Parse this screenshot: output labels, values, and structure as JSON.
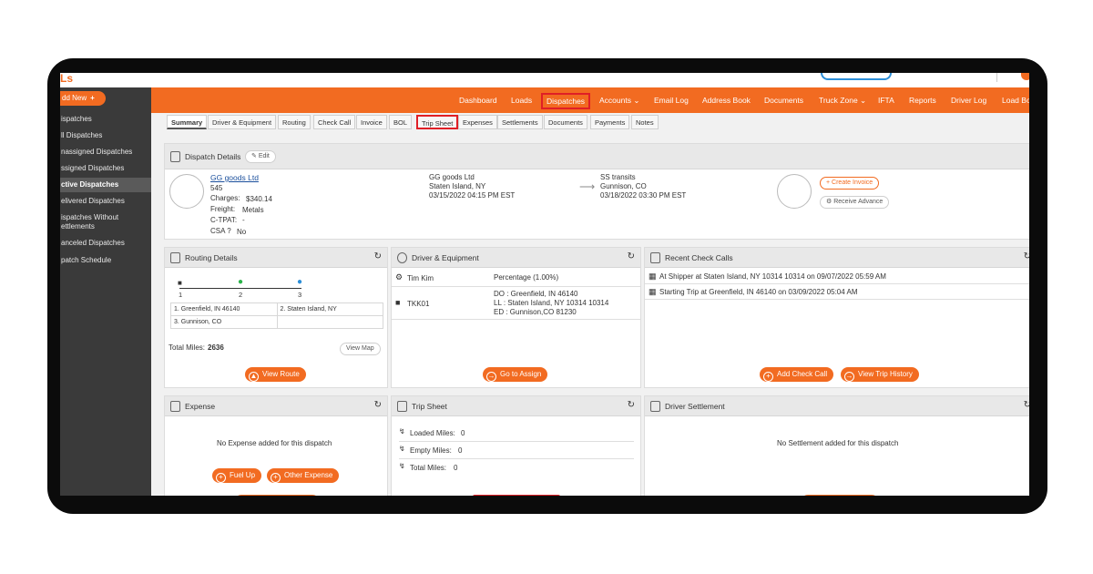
{
  "app": {
    "logo": "Ls"
  },
  "sidebar": {
    "add_new": "dd New",
    "items": [
      "ispatches",
      "ll Dispatches",
      "nassigned Dispatches",
      "ssigned Dispatches",
      "ctive Dispatches",
      "elivered Dispatches",
      "ispatches Without",
      "ettlements",
      "anceled Dispatches",
      "patch Schedule"
    ]
  },
  "nav": {
    "items": [
      "Dashboard",
      "Loads",
      "Dispatches",
      "Accounts ⌄",
      "Email Log",
      "Address Book",
      "Documents",
      "Truck Zone ⌄",
      "IFTA",
      "Reports",
      "Driver Log",
      "Load Bo"
    ]
  },
  "tabs": [
    "Summary",
    "Driver & Equipment",
    "Routing",
    "Check Call",
    "Invoice",
    "BOL",
    "Trip Sheet",
    "Expenses",
    "Settlements",
    "Documents",
    "Payments",
    "Notes"
  ],
  "dispatch_details": {
    "title": "Dispatch Details",
    "edit": "Edit",
    "customer": "GG goods Ltd",
    "load_no": "545",
    "charges_label": "Charges:",
    "charges_value": "$340.14",
    "freight_label": "Freight:",
    "freight_value": "Metals",
    "ctpat_label": "C-TPAT:",
    "ctpat_value": "-",
    "csa_label": "CSA ?",
    "csa_value": "No",
    "shipper_name": "GG goods Ltd",
    "shipper_city": "Staten Island, NY",
    "shipper_date": "03/15/2022 04:15 PM EST",
    "consignee_name": "SS transits",
    "consignee_city": "Gunnison, CO",
    "consignee_date": "03/18/2022 03:30 PM EST",
    "create_invoice": "Create Invoice",
    "receive_advance": "Receive Advance"
  },
  "routing": {
    "title": "Routing Details",
    "stop_nums": [
      "1",
      "2",
      "3"
    ],
    "stops": [
      "1. Greenfield, IN 46140",
      "2. Staten Island, NY",
      "3. Gunnison, CO",
      ""
    ],
    "total_miles_label": "Total Miles:",
    "total_miles_value": "2636",
    "view_map": "View Map",
    "view_route": "View Route"
  },
  "driver_equipment": {
    "title": "Driver & Equipment",
    "driver": "Tim Kim",
    "pay": "Percentage (1.00%)",
    "truck": "TKK01",
    "do_line": "DO :    Greenfield, IN 46140",
    "ll_line": "LL :    Staten Island, NY 10314 10314",
    "ed_line": "ED :    Gunnison,CO 81230",
    "go_assign": "Go to Assign"
  },
  "check_calls": {
    "title": "Recent Check Calls",
    "items": [
      "At Shipper at Staten Island, NY 10314 10314 on 09/07/2022 05:59 AM",
      "Starting Trip at Greenfield, IN 46140 on 03/09/2022 05:04 AM"
    ],
    "add_check_call": "Add Check Call",
    "view_trip_history": "View Trip History"
  },
  "expense": {
    "title": "Expense",
    "empty": "No Expense added for this dispatch",
    "fuel_up": "Fuel Up",
    "other_expense": "Other Expense"
  },
  "trip_sheet": {
    "title": "Trip Sheet",
    "loaded_label": "Loaded Miles:",
    "loaded_value": "0",
    "empty_label": "Empty Miles:",
    "empty_value": "0",
    "total_label": "Total Miles:",
    "total_value": "0"
  },
  "driver_settlement": {
    "title": "Driver Settlement",
    "empty": "No Settlement added for this dispatch"
  },
  "colors": {
    "accent": "#f26b21",
    "highlight": "#e01f26",
    "sidebar": "#3a3a3a"
  }
}
